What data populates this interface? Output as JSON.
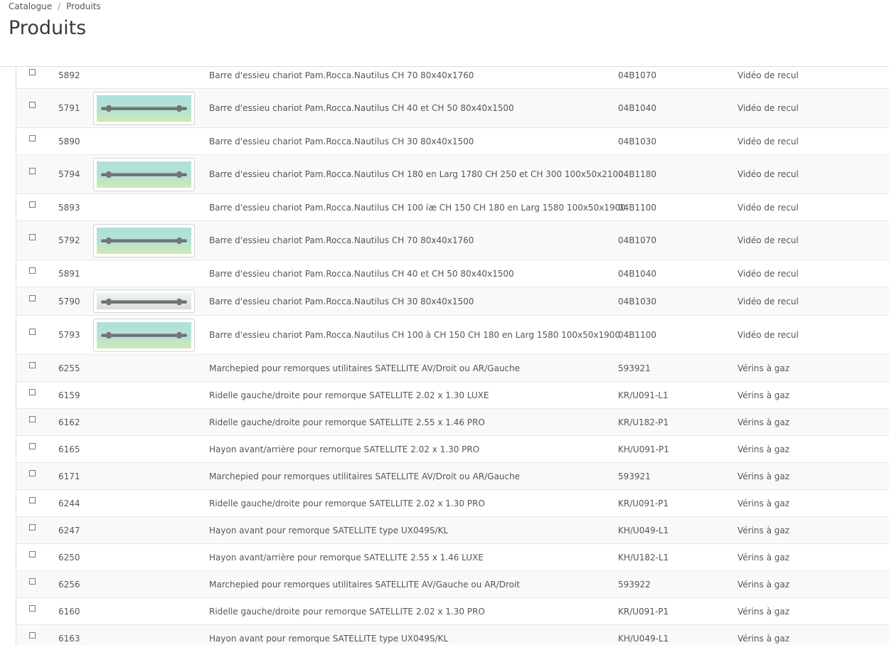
{
  "breadcrumb": {
    "parent": "Catalogue",
    "separator": "/",
    "current": "Produits"
  },
  "page_title": "Produits",
  "rows": [
    {
      "id": "5892",
      "image": "none",
      "name": "Barre d'essieu chariot Pam.Rocca.Nautilus CH 70 80x40x1760",
      "reference": "04B1070",
      "category": "Vidéo de recul"
    },
    {
      "id": "5791",
      "image": "large",
      "name": "Barre d'essieu chariot Pam.Rocca.Nautilus CH 40 et CH 50 80x40x1500",
      "reference": "04B1040",
      "category": "Vidéo de recul"
    },
    {
      "id": "5890",
      "image": "none",
      "name": "Barre d'essieu chariot Pam.Rocca.Nautilus CH 30 80x40x1500",
      "reference": "04B1030",
      "category": "Vidéo de recul"
    },
    {
      "id": "5794",
      "image": "large",
      "name": "Barre d'essieu chariot Pam.Rocca.Nautilus CH 180 en Larg 1780 CH 250 et CH 300 100x50x2100",
      "reference": "04B1180",
      "category": "Vidéo de recul"
    },
    {
      "id": "5893",
      "image": "none",
      "name": "Barre d'essieu chariot Pam.Rocca.Nautilus CH 100 íæ CH 150 CH 180 en Larg 1580 100x50x1900",
      "reference": "04B1100",
      "category": "Vidéo de recul"
    },
    {
      "id": "5792",
      "image": "large",
      "name": "Barre d'essieu chariot Pam.Rocca.Nautilus CH 70 80x40x1760",
      "reference": "04B1070",
      "category": "Vidéo de recul"
    },
    {
      "id": "5891",
      "image": "none",
      "name": "Barre d'essieu chariot Pam.Rocca.Nautilus CH 40 et CH 50 80x40x1500",
      "reference": "04B1040",
      "category": "Vidéo de recul"
    },
    {
      "id": "5790",
      "image": "small",
      "name": "Barre d'essieu chariot Pam.Rocca.Nautilus CH 30 80x40x1500",
      "reference": "04B1030",
      "category": "Vidéo de recul"
    },
    {
      "id": "5793",
      "image": "large",
      "name": "Barre d'essieu chariot Pam.Rocca.Nautilus CH 100 à CH 150 CH 180 en Larg 1580 100x50x1900",
      "reference": "04B1100",
      "category": "Vidéo de recul"
    },
    {
      "id": "6255",
      "image": "none",
      "name": "Marchepied pour remorques utilitaires SATELLITE AV/Droit ou AR/Gauche",
      "reference": "593921",
      "category": "Vérins à gaz"
    },
    {
      "id": "6159",
      "image": "none",
      "name": "Ridelle gauche/droite pour remorque SATELLITE 2.02 x 1.30 LUXE",
      "reference": "KR/U091-L1",
      "category": "Vérins à gaz"
    },
    {
      "id": "6162",
      "image": "none",
      "name": "Ridelle gauche/droite pour remorque SATELLITE 2.55 x 1.46 PRO",
      "reference": "KR/U182-P1",
      "category": "Vérins à gaz"
    },
    {
      "id": "6165",
      "image": "none",
      "name": "Hayon avant/arrière pour remorque SATELLITE 2.02 x 1.30 PRO",
      "reference": "KH/U091-P1",
      "category": "Vérins à gaz"
    },
    {
      "id": "6171",
      "image": "none",
      "name": "Marchepied pour remorques utilitaires SATELLITE AV/Droit ou AR/Gauche",
      "reference": "593921",
      "category": "Vérins à gaz"
    },
    {
      "id": "6244",
      "image": "none",
      "name": "Ridelle gauche/droite pour remorque SATELLITE 2.02 x 1.30 PRO",
      "reference": "KR/U091-P1",
      "category": "Vérins à gaz"
    },
    {
      "id": "6247",
      "image": "none",
      "name": "Hayon avant pour remorque SATELLITE type UX049S/KL",
      "reference": "KH/U049-L1",
      "category": "Vérins à gaz"
    },
    {
      "id": "6250",
      "image": "none",
      "name": "Hayon avant/arrière pour remorque SATELLITE 2.55 x 1.46 LUXE",
      "reference": "KH/U182-L1",
      "category": "Vérins à gaz"
    },
    {
      "id": "6256",
      "image": "none",
      "name": "Marchepied pour remorques utilitaires SATELLITE AV/Gauche ou AR/Droit",
      "reference": "593922",
      "category": "Vérins à gaz"
    },
    {
      "id": "6160",
      "image": "none",
      "name": "Ridelle gauche/droite pour remorque SATELLITE 2.02 x 1.30 PRO",
      "reference": "KR/U091-P1",
      "category": "Vérins à gaz"
    },
    {
      "id": "6163",
      "image": "none",
      "name": "Hayon avant pour remorque SATELLITE type UX049S/KL",
      "reference": "KH/U049-L1",
      "category": "Vérins à gaz"
    }
  ]
}
